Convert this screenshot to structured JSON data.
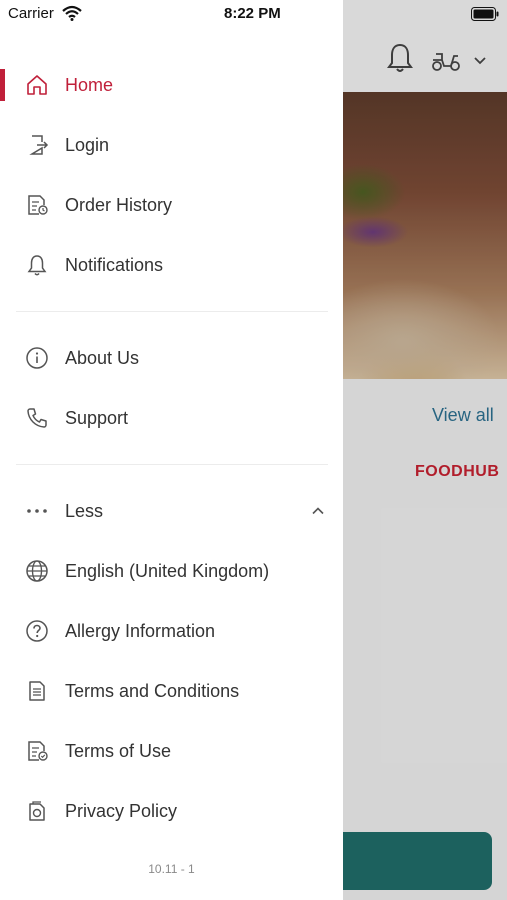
{
  "status_bar": {
    "carrier": "Carrier",
    "time": "8:22 PM"
  },
  "background": {
    "view_all": "View all",
    "brand": "FOODHUB"
  },
  "menu": {
    "primary": [
      {
        "label": "Home",
        "icon": "home-icon",
        "active": true
      },
      {
        "label": "Login",
        "icon": "login-icon"
      },
      {
        "label": "Order History",
        "icon": "order-history-icon"
      },
      {
        "label": "Notifications",
        "icon": "bell-icon"
      }
    ],
    "secondary": [
      {
        "label": "About Us",
        "icon": "info-icon"
      },
      {
        "label": "Support",
        "icon": "phone-icon"
      }
    ],
    "toggle": {
      "label": "Less",
      "icon": "more-dots-icon"
    },
    "more": [
      {
        "label": "English (United Kingdom)",
        "icon": "globe-icon"
      },
      {
        "label": "Allergy Information",
        "icon": "question-icon"
      },
      {
        "label": "Terms and Conditions",
        "icon": "document-icon"
      },
      {
        "label": "Terms of Use",
        "icon": "document-check-icon"
      },
      {
        "label": "Privacy Policy",
        "icon": "privacy-icon"
      }
    ]
  },
  "version": "10.11 - 1",
  "colors": {
    "accent": "#c0203a",
    "link": "#2b6d8d",
    "button": "#1f6a66"
  }
}
